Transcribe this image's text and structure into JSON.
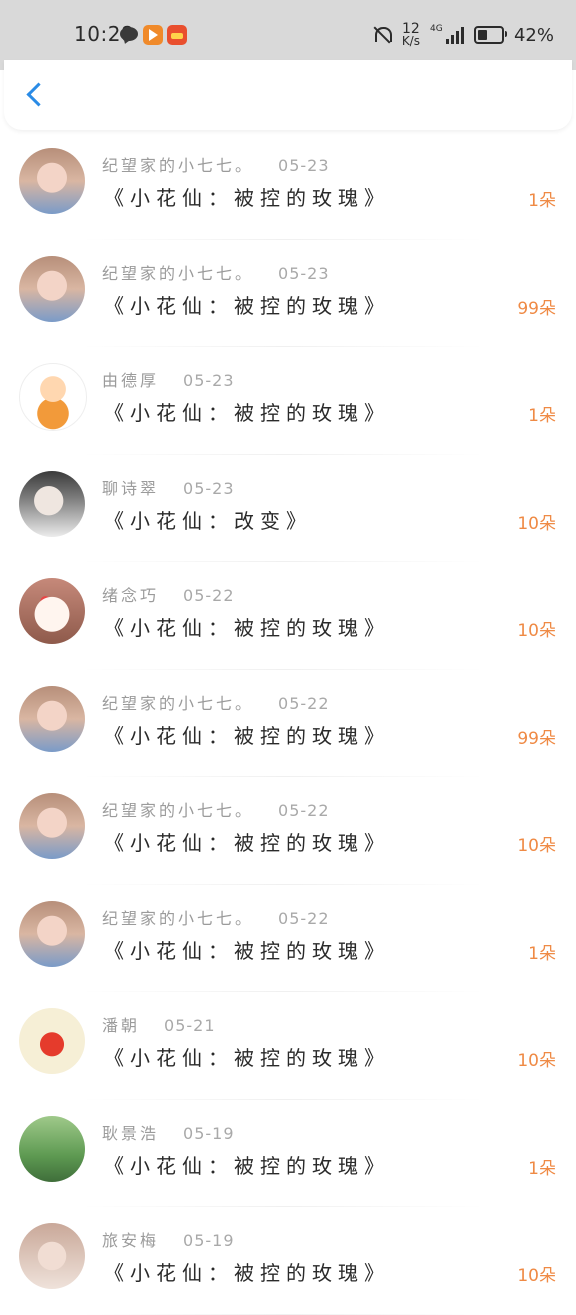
{
  "status_bar": {
    "time": "10:28",
    "icons": [
      "chat-bubble-icon",
      "video-app-icon",
      "store-app-icon"
    ],
    "net_speed_value": "12",
    "net_speed_unit": "K/s",
    "network_label": "4G",
    "battery_level": 0.42,
    "battery_percent": "42%"
  },
  "nav": {
    "back_icon": "chevron-left-icon",
    "accent_color": "#2a8be6"
  },
  "gifts": [
    {
      "sender": "纪望家的小七七。",
      "date": "05-23",
      "gift": "《小花仙：被控的玫瑰》",
      "count": "1朵",
      "avatar": "girl"
    },
    {
      "sender": "纪望家的小七七。",
      "date": "05-23",
      "gift": "《小花仙：被控的玫瑰》",
      "count": "99朵",
      "avatar": "girl"
    },
    {
      "sender": "由德厚",
      "date": "05-23",
      "gift": "《小花仙：被控的玫瑰》",
      "count": "1朵",
      "avatar": "cartoon"
    },
    {
      "sender": "聊诗翠",
      "date": "05-23",
      "gift": "《小花仙：改变》",
      "count": "10朵",
      "avatar": "sketch"
    },
    {
      "sender": "绪念巧",
      "date": "05-22",
      "gift": "《小花仙：被控的玫瑰》",
      "count": "10朵",
      "avatar": "cake"
    },
    {
      "sender": "纪望家的小七七。",
      "date": "05-22",
      "gift": "《小花仙：被控的玫瑰》",
      "count": "99朵",
      "avatar": "girl"
    },
    {
      "sender": "纪望家的小七七。",
      "date": "05-22",
      "gift": "《小花仙：被控的玫瑰》",
      "count": "10朵",
      "avatar": "girl"
    },
    {
      "sender": "纪望家的小七七。",
      "date": "05-22",
      "gift": "《小花仙：被控的玫瑰》",
      "count": "1朵",
      "avatar": "girl"
    },
    {
      "sender": "潘朝",
      "date": "05-21",
      "gift": "《小花仙：被控的玫瑰》",
      "count": "10朵",
      "avatar": "apple"
    },
    {
      "sender": "耿景浩",
      "date": "05-19",
      "gift": "《小花仙：被控的玫瑰》",
      "count": "1朵",
      "avatar": "boy"
    },
    {
      "sender": "旅安梅",
      "date": "05-19",
      "gift": "《小花仙：被控的玫瑰》",
      "count": "10朵",
      "avatar": "girl2"
    }
  ],
  "colors": {
    "count_color": "#ef8a45",
    "sender_color": "#9b9b9b",
    "status_bar_bg": "#d9d9d9"
  }
}
